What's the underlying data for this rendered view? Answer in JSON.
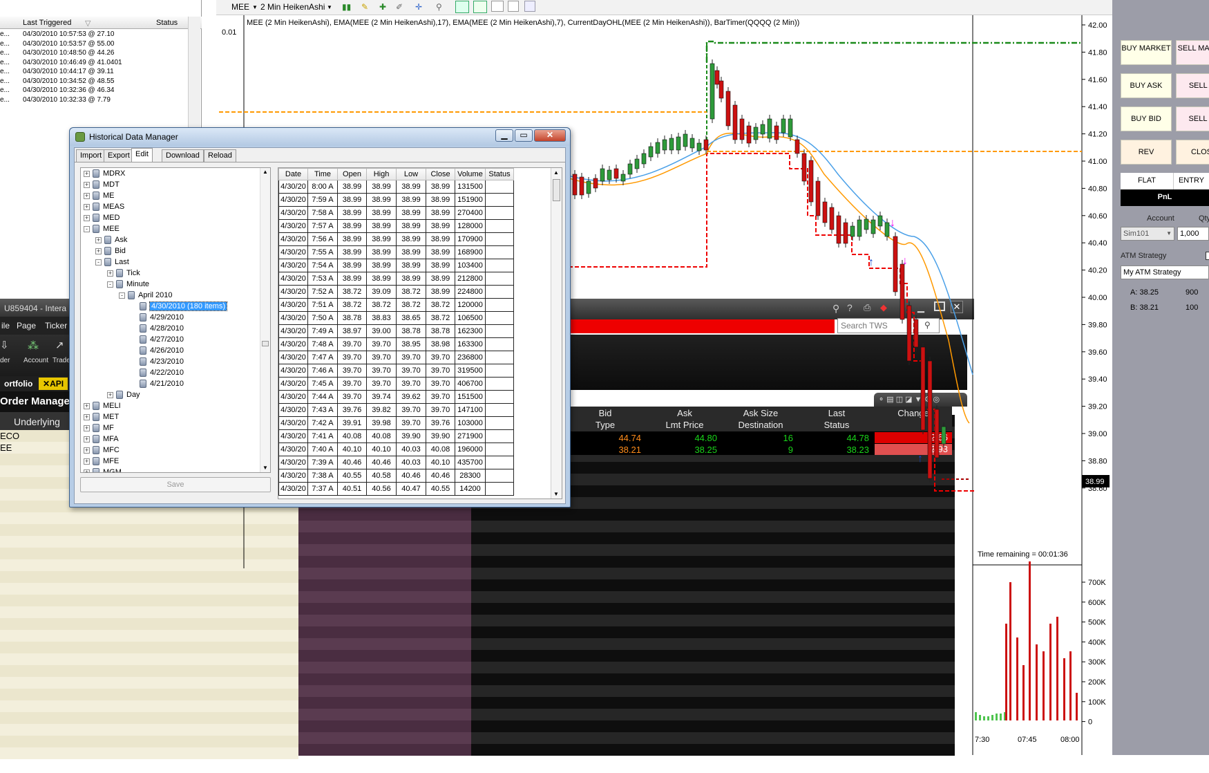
{
  "alerts": {
    "headers": [
      "Last Triggered",
      "Status"
    ],
    "rows": [
      {
        "a": "e...",
        "b": "04/30/2010 10:57:53 @ 27.10"
      },
      {
        "a": "e...",
        "b": "04/30/2010 10:53:57 @ 55.00"
      },
      {
        "a": "e...",
        "b": "04/30/2010 10:48:50 @ 44.26"
      },
      {
        "a": "e...",
        "b": "04/30/2010 10:46:49 @ 41.0401"
      },
      {
        "a": "e...",
        "b": "04/30/2010 10:44:17 @ 39.11"
      },
      {
        "a": "e...",
        "b": "04/30/2010 10:34:52 @ 48.55"
      },
      {
        "a": "e...",
        "b": "04/30/2010 10:32:36 @ 46.34"
      },
      {
        "a": "e...",
        "b": "04/30/2010 10:32:33 @ 7.79"
      }
    ]
  },
  "tws": {
    "window_title": "U859404 - Intera",
    "menu": [
      "ile",
      "Page",
      "Ticker"
    ],
    "toolbar": [
      "der",
      "Account",
      "Trade"
    ],
    "tabs": [
      "ortfolio",
      "API"
    ],
    "order_manager_title": "Order Manager",
    "underlying_label": "Underlying",
    "underlying_rows": [
      "ECO",
      "EE"
    ],
    "search_placeholder": "Search TWS",
    "market_headers_top": [
      "Bid",
      "Ask",
      "Ask Size",
      "Last",
      "Change"
    ],
    "market_headers_bottom": [
      "Type",
      "Lmt Price",
      "Destination",
      "Status"
    ],
    "market_rows": [
      {
        "bid": "44.74",
        "ask": "44.80",
        "ask_size": "16",
        "last": "44.78",
        "change": "-2.66"
      },
      {
        "bid": "38.21",
        "ask": "38.25",
        "ask_size": "9",
        "last": "38.23",
        "change": "-2.93"
      }
    ]
  },
  "chart": {
    "symbol": "MEE",
    "period": "2 Min HeikenAshi",
    "indicator_label": "MEE (2 Min HeikenAshi), EMA(MEE (2 Min HeikenAshi),17), EMA(MEE (2 Min HeikenAshi),7), CurrentDayOHL(MEE (2 Min HeikenAshi)), BarTimer(QQQQ (2 Min))",
    "tick_size_label": "0.01",
    "price_axis": [
      "42.00",
      "41.80",
      "41.60",
      "41.40",
      "41.20",
      "41.00",
      "40.80",
      "40.60",
      "40.40",
      "40.20",
      "40.00",
      "39.80",
      "39.60",
      "39.40",
      "39.20",
      "39.00",
      "38.80",
      "38.60"
    ],
    "last_price_label": "38.99",
    "timer_text": "Time remaining = 00:01:36",
    "volume_axis": [
      "700K",
      "600K",
      "500K",
      "400K",
      "300K",
      "200K",
      "100K",
      "0"
    ],
    "time_axis": [
      "7:30",
      "07:45",
      "08:00"
    ]
  },
  "trader": {
    "buy_market": "BUY MARKET",
    "sell_market": "SELL MARKE",
    "buy_ask": "BUY ASK",
    "sell_ask": "SELL A",
    "buy_bid": "BUY BID",
    "sell_bid": "SELL B",
    "rev": "REV",
    "close": "CLOS",
    "flat": "FLAT",
    "entry": "ENTRY",
    "pnl": "PnL",
    "account_label": "Account",
    "qty_label": "Qty",
    "account_value": "Sim101",
    "qty_value": "1,000",
    "atm_label": "ATM Strategy",
    "atm_value": "My ATM Strategy",
    "ask_line": "A: 38.25",
    "ask_qty": "900",
    "bid_line": "B: 38.21",
    "bid_qty": "100"
  },
  "hdm": {
    "title": "Historical Data Manager",
    "tabs": [
      "Import",
      "Export",
      "Edit",
      "Download",
      "Reload"
    ],
    "save_label": "Save",
    "tree": [
      {
        "label": "MDRX",
        "indent": 0,
        "pm": "+"
      },
      {
        "label": "MDT",
        "indent": 0,
        "pm": "+"
      },
      {
        "label": "ME",
        "indent": 0,
        "pm": "+"
      },
      {
        "label": "MEAS",
        "indent": 0,
        "pm": "+"
      },
      {
        "label": "MED",
        "indent": 0,
        "pm": "+"
      },
      {
        "label": "MEE",
        "indent": 0,
        "pm": "-"
      },
      {
        "label": "Ask",
        "indent": 1,
        "pm": "+"
      },
      {
        "label": "Bid",
        "indent": 1,
        "pm": "+"
      },
      {
        "label": "Last",
        "indent": 1,
        "pm": "-"
      },
      {
        "label": "Tick",
        "indent": 2,
        "pm": "+"
      },
      {
        "label": "Minute",
        "indent": 2,
        "pm": "-"
      },
      {
        "label": "April 2010",
        "indent": 3,
        "pm": "-"
      },
      {
        "label": "4/30/2010 (180 items)",
        "indent": 4,
        "pm": "",
        "selected": true
      },
      {
        "label": "4/29/2010",
        "indent": 4,
        "pm": ""
      },
      {
        "label": "4/28/2010",
        "indent": 4,
        "pm": ""
      },
      {
        "label": "4/27/2010",
        "indent": 4,
        "pm": ""
      },
      {
        "label": "4/26/2010",
        "indent": 4,
        "pm": ""
      },
      {
        "label": "4/23/2010",
        "indent": 4,
        "pm": ""
      },
      {
        "label": "4/22/2010",
        "indent": 4,
        "pm": ""
      },
      {
        "label": "4/21/2010",
        "indent": 4,
        "pm": ""
      },
      {
        "label": "Day",
        "indent": 2,
        "pm": "+"
      },
      {
        "label": "MELI",
        "indent": 0,
        "pm": "+"
      },
      {
        "label": "MET",
        "indent": 0,
        "pm": "+"
      },
      {
        "label": "MF",
        "indent": 0,
        "pm": "+"
      },
      {
        "label": "MFA",
        "indent": 0,
        "pm": "+"
      },
      {
        "label": "MFC",
        "indent": 0,
        "pm": "+"
      },
      {
        "label": "MFE",
        "indent": 0,
        "pm": "+"
      },
      {
        "label": "MGM",
        "indent": 0,
        "pm": "+"
      }
    ],
    "columns": [
      "Date",
      "Time",
      "Open",
      "High",
      "Low",
      "Close",
      "Volume",
      "Status"
    ],
    "rows": [
      [
        "4/30/20",
        "8:00 A",
        "38.99",
        "38.99",
        "38.99",
        "38.99",
        "131500",
        ""
      ],
      [
        "4/30/20",
        "7:59 A",
        "38.99",
        "38.99",
        "38.99",
        "38.99",
        "151900",
        ""
      ],
      [
        "4/30/20",
        "7:58 A",
        "38.99",
        "38.99",
        "38.99",
        "38.99",
        "270400",
        ""
      ],
      [
        "4/30/20",
        "7:57 A",
        "38.99",
        "38.99",
        "38.99",
        "38.99",
        "128000",
        ""
      ],
      [
        "4/30/20",
        "7:56 A",
        "38.99",
        "38.99",
        "38.99",
        "38.99",
        "170900",
        ""
      ],
      [
        "4/30/20",
        "7:55 A",
        "38.99",
        "38.99",
        "38.99",
        "38.99",
        "168900",
        ""
      ],
      [
        "4/30/20",
        "7:54 A",
        "38.99",
        "38.99",
        "38.99",
        "38.99",
        "103400",
        ""
      ],
      [
        "4/30/20",
        "7:53 A",
        "38.99",
        "38.99",
        "38.99",
        "38.99",
        "212800",
        ""
      ],
      [
        "4/30/20",
        "7:52 A",
        "38.72",
        "39.09",
        "38.72",
        "38.99",
        "224800",
        ""
      ],
      [
        "4/30/20",
        "7:51 A",
        "38.72",
        "38.72",
        "38.72",
        "38.72",
        "120000",
        ""
      ],
      [
        "4/30/20",
        "7:50 A",
        "38.78",
        "38.83",
        "38.65",
        "38.72",
        "106500",
        ""
      ],
      [
        "4/30/20",
        "7:49 A",
        "38.97",
        "39.00",
        "38.78",
        "38.78",
        "162300",
        ""
      ],
      [
        "4/30/20",
        "7:48 A",
        "39.70",
        "39.70",
        "38.95",
        "38.98",
        "163300",
        ""
      ],
      [
        "4/30/20",
        "7:47 A",
        "39.70",
        "39.70",
        "39.70",
        "39.70",
        "236800",
        ""
      ],
      [
        "4/30/20",
        "7:46 A",
        "39.70",
        "39.70",
        "39.70",
        "39.70",
        "319500",
        ""
      ],
      [
        "4/30/20",
        "7:45 A",
        "39.70",
        "39.70",
        "39.70",
        "39.70",
        "406700",
        ""
      ],
      [
        "4/30/20",
        "7:44 A",
        "39.70",
        "39.74",
        "39.62",
        "39.70",
        "151500",
        ""
      ],
      [
        "4/30/20",
        "7:43 A",
        "39.76",
        "39.82",
        "39.70",
        "39.70",
        "147100",
        ""
      ],
      [
        "4/30/20",
        "7:42 A",
        "39.91",
        "39.98",
        "39.70",
        "39.76",
        "103000",
        ""
      ],
      [
        "4/30/20",
        "7:41 A",
        "40.08",
        "40.08",
        "39.90",
        "39.90",
        "271900",
        ""
      ],
      [
        "4/30/20",
        "7:40 A",
        "40.10",
        "40.10",
        "40.03",
        "40.08",
        "196000",
        ""
      ],
      [
        "4/30/20",
        "7:39 A",
        "40.46",
        "40.46",
        "40.03",
        "40.10",
        "435700",
        ""
      ],
      [
        "4/30/20",
        "7:38 A",
        "40.55",
        "40.58",
        "40.46",
        "40.46",
        "28300",
        ""
      ],
      [
        "4/30/20",
        "7:37 A",
        "40.51",
        "40.56",
        "40.47",
        "40.55",
        "14200",
        ""
      ]
    ]
  },
  "colors": {
    "chart_up": "#2e9a3a",
    "chart_down": "#cc1111",
    "ema_fast": "#ff9900",
    "ema_slow": "#4aa0e8",
    "day_high": "#1a8a1a",
    "day_open": "#ff9900",
    "day_low": "#ee0000",
    "trader_bg": "#9c9da8",
    "hdm_frame": "#b7cde6"
  }
}
